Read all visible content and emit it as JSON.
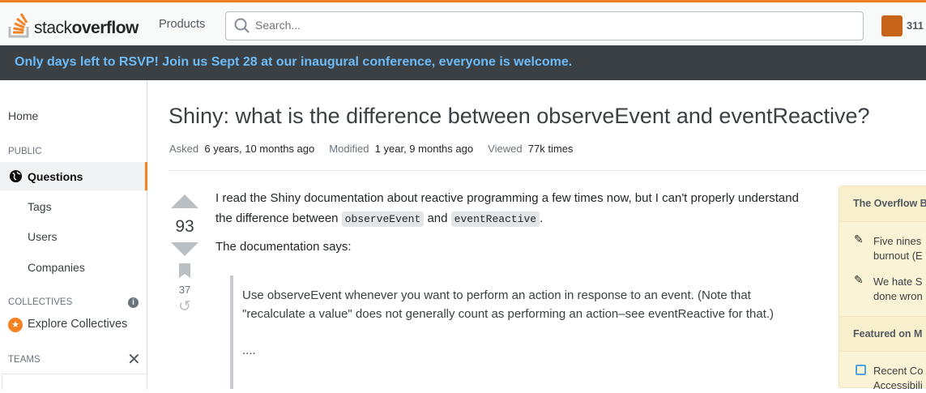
{
  "header": {
    "logo_light": "stack",
    "logo_bold": "overflow",
    "products": "Products",
    "search_placeholder": "Search...",
    "reputation": "311"
  },
  "banner": "Only days left to RSVP! Join us Sept 28 at our inaugural conference, everyone is welcome.",
  "sidebar": {
    "home": "Home",
    "public": "PUBLIC",
    "questions": "Questions",
    "tags": "Tags",
    "users": "Users",
    "companies": "Companies",
    "collectives": "COLLECTIVES",
    "explore": "Explore Collectives",
    "teams": "TEAMS"
  },
  "question": {
    "title": "Shiny: what is the difference between observeEvent and eventReactive?",
    "asked_label": "Asked",
    "asked": "6 years, 10 months ago",
    "modified_label": "Modified",
    "modified": "1 year, 9 months ago",
    "viewed_label": "Viewed",
    "viewed": "77k times",
    "votes": "93",
    "bookmarks": "37",
    "p1a": "I read the Shiny documentation about reactive programming a few times now, but I can't properly understand the difference between ",
    "code1": "observeEvent",
    "p1b": " and ",
    "code2": "eventReactive",
    "p1c": ".",
    "p2": "The documentation says:",
    "quote1": "Use observeEvent whenever you want to perform an action in response to an event. (Note that \"recalculate a value\" does not generally count as performing an action–see eventReactive for that.)",
    "quote2": "...."
  },
  "overflow": {
    "title": "The Overflow Blog",
    "item1a": "Five nines",
    "item1b": "burnout (E",
    "item2a": "We hate S",
    "item2b": "done wron",
    "featured": "Featured on M",
    "item3a": "Recent Co",
    "item3b": "Accessibili"
  }
}
